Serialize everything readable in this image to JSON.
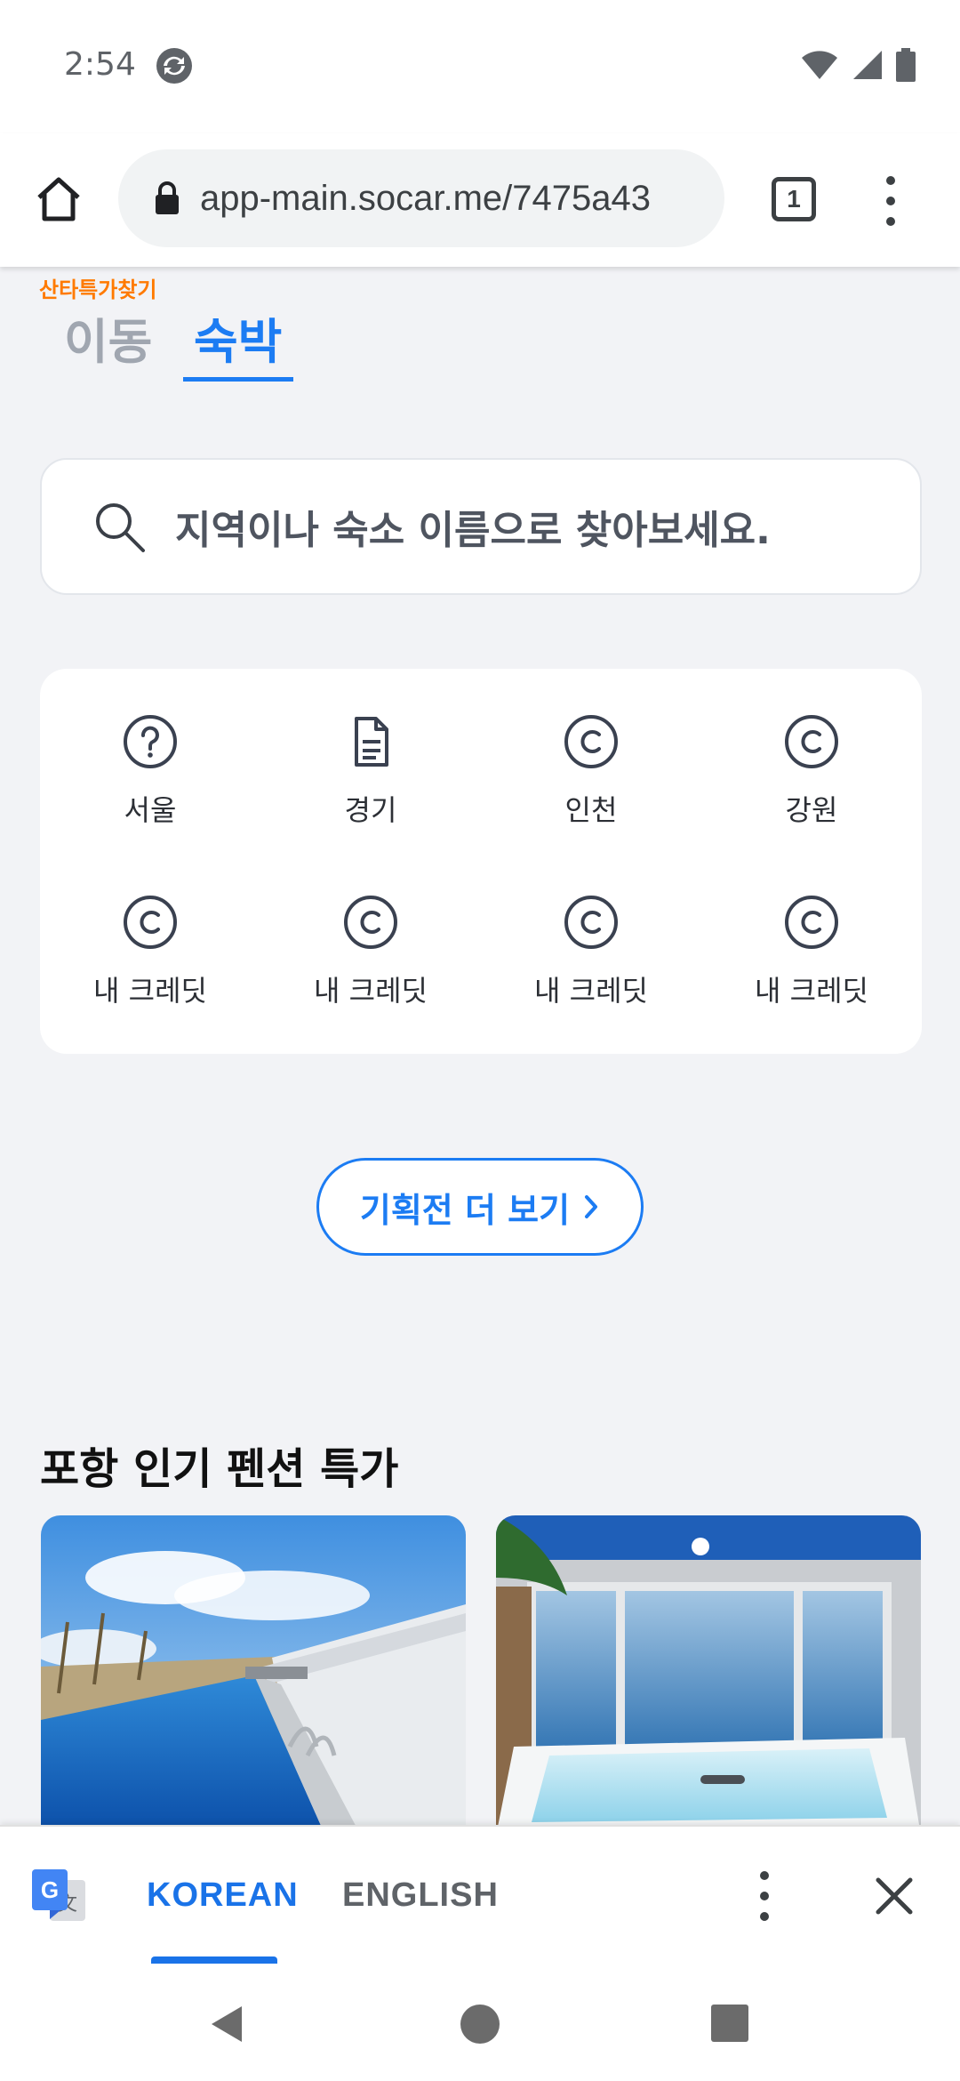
{
  "status_bar": {
    "time": "2:54",
    "icons": [
      "sync-app-icon",
      "wifi-icon",
      "signal-icon",
      "battery-icon"
    ]
  },
  "browser": {
    "url": "app-main.socar.me/7475a43",
    "tab_count": "1",
    "icons": [
      "home-icon",
      "lock-icon",
      "more-vert-icon"
    ]
  },
  "page": {
    "promo_label": "산타특가찾기",
    "tabs": [
      {
        "label": "이동",
        "active": false
      },
      {
        "label": "숙박",
        "active": true
      }
    ],
    "search": {
      "placeholder": "지역이나 숙소 이름으로 찾아보세요."
    },
    "categories": [
      {
        "label": "서울",
        "icon": "question-circle-icon"
      },
      {
        "label": "경기",
        "icon": "document-icon"
      },
      {
        "label": "인천",
        "icon": "copyright-icon"
      },
      {
        "label": "강원",
        "icon": "copyright-icon"
      },
      {
        "label": "내 크레딧",
        "icon": "copyright-icon"
      },
      {
        "label": "내 크레딧",
        "icon": "copyright-icon"
      },
      {
        "label": "내 크레딧",
        "icon": "copyright-icon"
      },
      {
        "label": "내 크레딧",
        "icon": "copyright-icon"
      }
    ],
    "more_exhibit_button": "기획전 더 보기",
    "section_title": "포항 인기 펜션 특가",
    "photos": [
      "pool-photo",
      "jacuzzi-photo"
    ]
  },
  "translate_bar": {
    "languages": [
      "KOREAN",
      "ENGLISH"
    ],
    "active_language": "KOREAN"
  },
  "colors": {
    "accent": "#1c7cf3",
    "promo": "#ff7a00",
    "background": "#f2f3f6",
    "google_blue": "#1a73e8"
  }
}
